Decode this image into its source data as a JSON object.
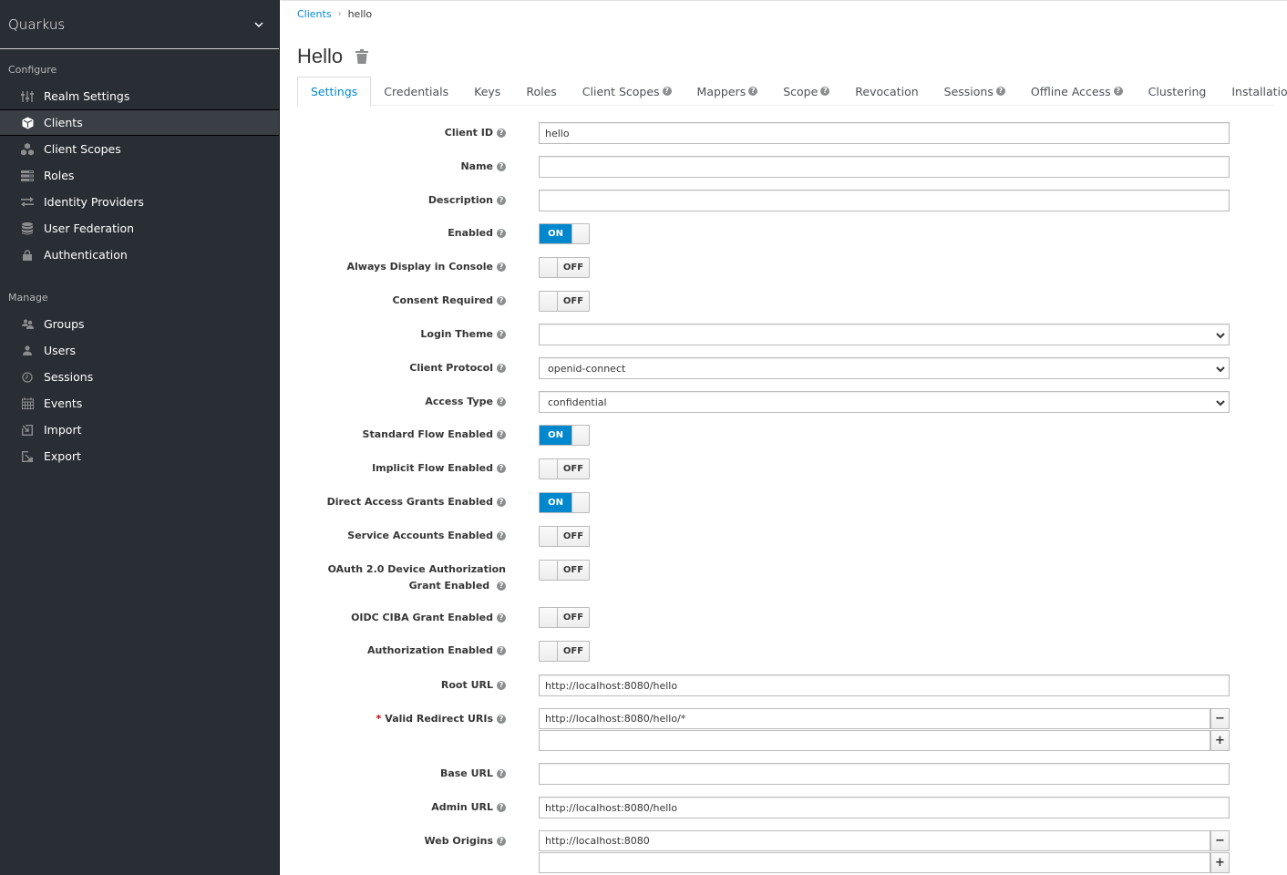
{
  "sidebar": {
    "realm": "Quarkus",
    "configure_title": "Configure",
    "manage_title": "Manage",
    "configure_items": [
      {
        "label": "Realm Settings",
        "icon": "sliders-icon"
      },
      {
        "label": "Clients",
        "icon": "cube-icon",
        "active": true
      },
      {
        "label": "Client Scopes",
        "icon": "cubes-icon"
      },
      {
        "label": "Roles",
        "icon": "list-icon"
      },
      {
        "label": "Identity Providers",
        "icon": "exchange-icon"
      },
      {
        "label": "User Federation",
        "icon": "database-icon"
      },
      {
        "label": "Authentication",
        "icon": "lock-icon"
      }
    ],
    "manage_items": [
      {
        "label": "Groups",
        "icon": "users-icon"
      },
      {
        "label": "Users",
        "icon": "user-icon"
      },
      {
        "label": "Sessions",
        "icon": "clock-icon"
      },
      {
        "label": "Events",
        "icon": "calendar-icon"
      },
      {
        "label": "Import",
        "icon": "import-icon"
      },
      {
        "label": "Export",
        "icon": "export-icon"
      }
    ]
  },
  "breadcrumb": {
    "parent": "Clients",
    "separator": "›",
    "current": "hello"
  },
  "page_title": "Hello",
  "tabs": [
    {
      "label": "Settings",
      "active": true,
      "help": false
    },
    {
      "label": "Credentials",
      "help": false
    },
    {
      "label": "Keys",
      "help": false
    },
    {
      "label": "Roles",
      "help": false
    },
    {
      "label": "Client Scopes",
      "help": true
    },
    {
      "label": "Mappers",
      "help": true
    },
    {
      "label": "Scope",
      "help": true
    },
    {
      "label": "Revocation",
      "help": false
    },
    {
      "label": "Sessions",
      "help": true
    },
    {
      "label": "Offline Access",
      "help": true
    },
    {
      "label": "Clustering",
      "help": false
    },
    {
      "label": "Installation",
      "help": true
    }
  ],
  "form": {
    "client_id": {
      "label": "Client ID",
      "value": "hello"
    },
    "name": {
      "label": "Name",
      "value": ""
    },
    "description": {
      "label": "Description",
      "value": ""
    },
    "enabled": {
      "label": "Enabled",
      "on": true
    },
    "always_display": {
      "label": "Always Display in Console",
      "on": false
    },
    "consent_required": {
      "label": "Consent Required",
      "on": false
    },
    "login_theme": {
      "label": "Login Theme",
      "value": ""
    },
    "client_protocol": {
      "label": "Client Protocol",
      "value": "openid-connect"
    },
    "access_type": {
      "label": "Access Type",
      "value": "confidential"
    },
    "standard_flow": {
      "label": "Standard Flow Enabled",
      "on": true
    },
    "implicit_flow": {
      "label": "Implicit Flow Enabled",
      "on": false
    },
    "direct_access": {
      "label": "Direct Access Grants Enabled",
      "on": true
    },
    "service_accounts": {
      "label": "Service Accounts Enabled",
      "on": false
    },
    "device_grant": {
      "label": "OAuth 2.0 Device Authorization Grant Enabled",
      "on": false
    },
    "ciba_grant": {
      "label": "OIDC CIBA Grant Enabled",
      "on": false
    },
    "authorization": {
      "label": "Authorization Enabled",
      "on": false
    },
    "root_url": {
      "label": "Root URL",
      "value": "http://localhost:8080/hello"
    },
    "redirect_uris": {
      "label": "Valid Redirect URIs",
      "required": true,
      "values": [
        "http://localhost:8080/hello/*",
        ""
      ]
    },
    "base_url": {
      "label": "Base URL",
      "value": ""
    },
    "admin_url": {
      "label": "Admin URL",
      "value": "http://localhost:8080/hello"
    },
    "web_origins": {
      "label": "Web Origins",
      "values": [
        "http://localhost:8080",
        ""
      ]
    }
  },
  "toggle_text": {
    "on": "ON",
    "off": "OFF"
  },
  "required_mark": "*",
  "help_glyph": "?",
  "remove_glyph": "−",
  "add_glyph": "+",
  "colors": {
    "accent": "#0088ce",
    "sidebar_bg": "#292e34",
    "required": "#cc0000"
  }
}
